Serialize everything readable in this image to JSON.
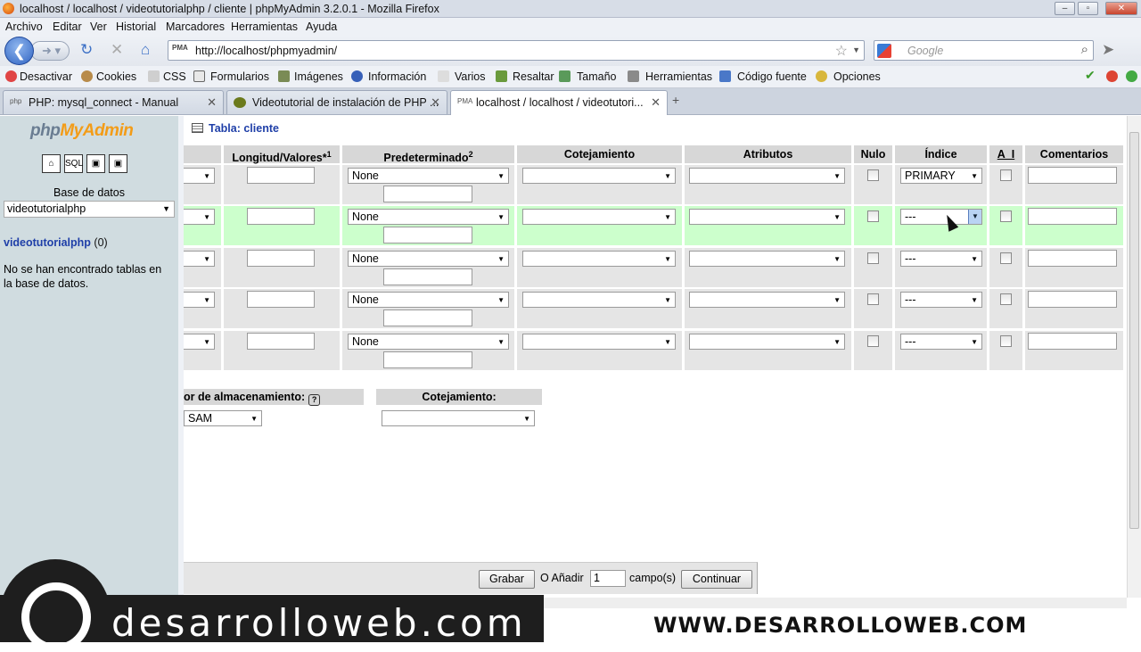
{
  "window": {
    "title": "localhost / localhost / videotutorialphp / cliente | phpMyAdmin 3.2.0.1 - Mozilla Firefox"
  },
  "menu": [
    "Archivo",
    "Editar",
    "Ver",
    "Historial",
    "Marcadores",
    "Herramientas",
    "Ayuda"
  ],
  "address": {
    "url": "http://localhost/phpmyadmin/",
    "search_placeholder": "Google"
  },
  "devtoolbar": [
    "Desactivar",
    "Cookies",
    "CSS",
    "Formularios",
    "Imágenes",
    "Información",
    "Varios",
    "Resaltar",
    "Tamaño",
    "Herramientas",
    "Código fuente",
    "Opciones"
  ],
  "tabs": [
    {
      "label": "PHP: mysql_connect - Manual"
    },
    {
      "label": "Videotutorial de instalación de PHP ..."
    },
    {
      "label": "localhost / localhost / videotutori..."
    }
  ],
  "sidebar": {
    "logo_a": "php",
    "logo_b": "MyAdmin",
    "db_label": "Base de datos",
    "db_selected": "videotutorialphp",
    "db_link": "videotutorialphp",
    "db_count": "(0)",
    "no_tables": "No se han encontrado tablas en la base de datos."
  },
  "main": {
    "page_title": "Tabla: cliente",
    "headers": {
      "longitud": "Longitud/Valores*",
      "longitud_sup": "1",
      "predeterminado": "Predeterminado",
      "predeterminado_sup": "2",
      "cotejamiento": "Cotejamiento",
      "atributos": "Atributos",
      "nulo": "Nulo",
      "indice": "Índice",
      "ai": "A_I",
      "comentarios": "Comentarios"
    },
    "rows": [
      {
        "default": "None",
        "index": "PRIMARY"
      },
      {
        "default": "None",
        "index": "---"
      },
      {
        "default": "None",
        "index": "---"
      },
      {
        "default": "None",
        "index": "---"
      },
      {
        "default": "None",
        "index": "---"
      }
    ],
    "storage_label": "or de almacenamiento:",
    "storage_value": "SAM",
    "collation_label": "Cotejamiento:",
    "save_button": "Grabar",
    "add_label": "O Añadir",
    "add_count": "1",
    "fields_label": "campo(s)",
    "continue_button": "Continuar"
  },
  "banner": {
    "left": "desarrolloweb.com",
    "right": "WWW.DESARROLLOWEB.COM"
  },
  "colors": {
    "highlight_row": "#ccffcc",
    "row_bg": "#e5e5e5",
    "header_bg": "#d7d7d7",
    "sidebar_bg": "#d0dce0"
  }
}
